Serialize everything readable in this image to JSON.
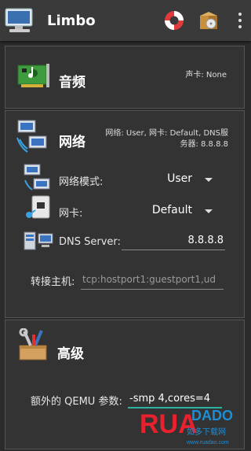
{
  "appbar": {
    "title": "Limbo",
    "icons": [
      "computer-icon",
      "lifebuoy-icon",
      "install-box-icon",
      "overflow-menu-icon"
    ]
  },
  "audio": {
    "title": "音频",
    "summary": "声卡: None"
  },
  "network": {
    "title": "网络",
    "summary_line1": "网络: User, 网卡: Default, DNS服",
    "summary_line2": "务器: 8.8.8.8",
    "mode_label": "网络模式:",
    "mode_value": "User",
    "nic_label": "网卡:",
    "nic_value": "Default",
    "dns_label": "DNS Server:",
    "dns_value": "8.8.8.8",
    "forward_label": "转接主机:",
    "forward_hint": "tcp:hostport1:guestport1,ud"
  },
  "advanced": {
    "title": "高级",
    "qemu_label": "额外的 QEMU 参数:",
    "qemu_value": "-smp 4,cores=4"
  },
  "watermark": {
    "logo": "RUADADO",
    "tagline": "如多下载网",
    "url": "www.ruadao.com"
  },
  "colors": {
    "accent": "#2bb3a0",
    "panel": "#333333",
    "background": "#2b2b2b"
  }
}
